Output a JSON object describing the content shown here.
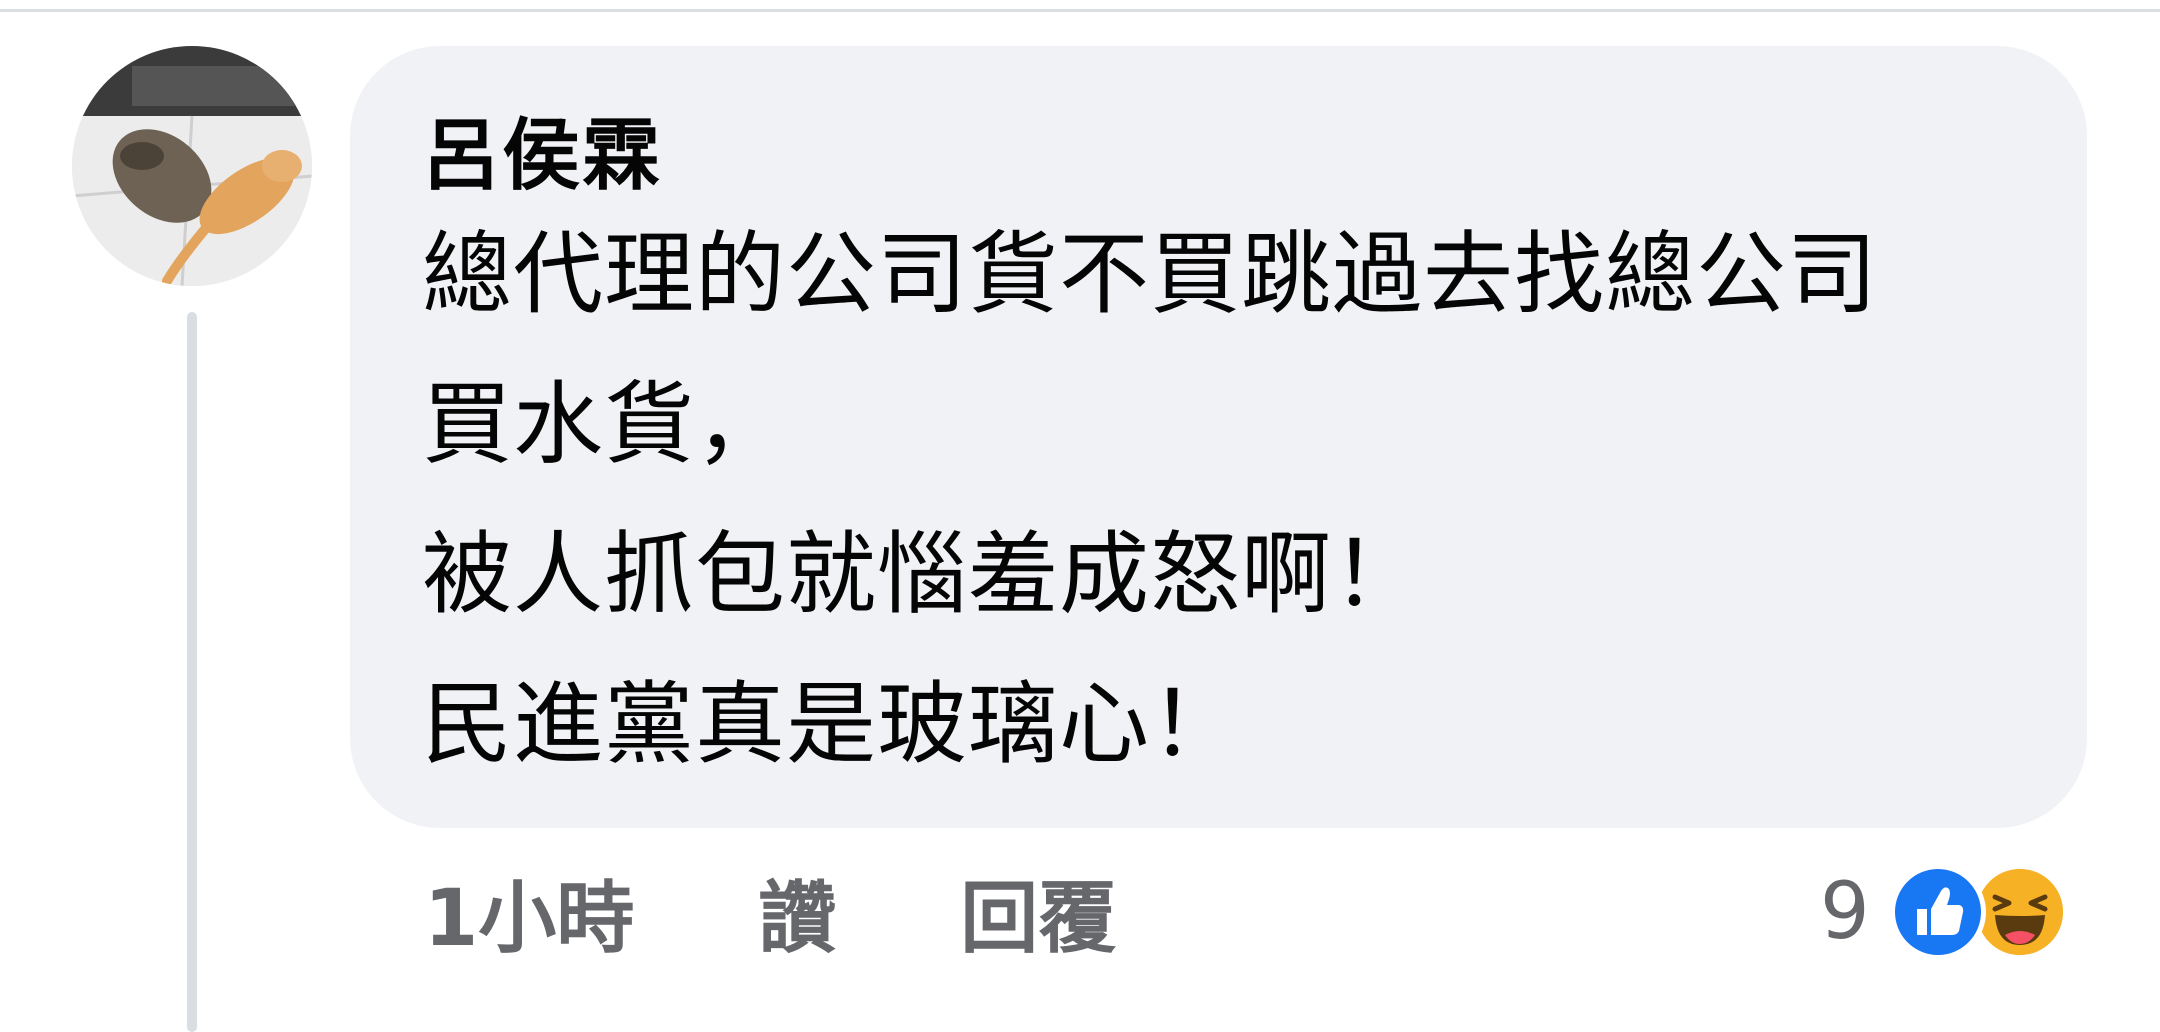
{
  "comment": {
    "author": "呂侯霖",
    "lines": [
      "總代理的公司貨不買跳過去找總公司",
      "買水貨，",
      "被人抓包就惱羞成怒啊！",
      "民進黨真是玻璃心！"
    ]
  },
  "meta": {
    "time": "1小時",
    "like_label": "讚",
    "reply_label": "回覆"
  },
  "reactions": {
    "count": "9",
    "icons": [
      "like-icon",
      "haha-icon"
    ]
  },
  "colors": {
    "bubble": "#f0f2f5",
    "meta_text": "#65676b",
    "like_blue": "#1877f2",
    "haha_yellow": "#f7b125"
  }
}
